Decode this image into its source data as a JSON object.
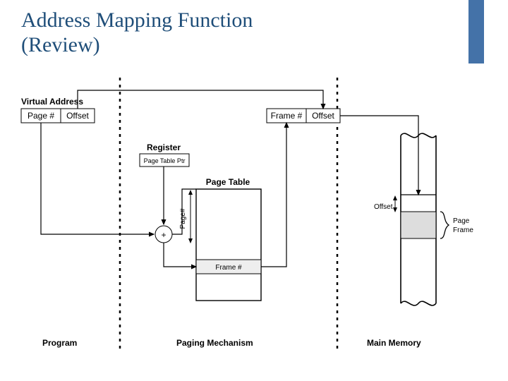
{
  "title_line1": "Address Mapping Function",
  "title_line2": "(Review)",
  "labels": {
    "virtual_address": "Virtual Address",
    "page_num": "Page #",
    "offset": "Offset",
    "register": "Register",
    "page_table_ptr": "Page Table Ptr",
    "page_table": "Page Table",
    "frame_num": "Frame #",
    "frame_num2": "Frame #",
    "offset2": "Offset",
    "page_num_vertical": "Page#",
    "offset3": "Offset",
    "page_frame_l1": "Page",
    "page_frame_l2": "Frame",
    "program": "Program",
    "paging_mechanism": "Paging Mechanism",
    "main_memory": "Main Memory"
  }
}
